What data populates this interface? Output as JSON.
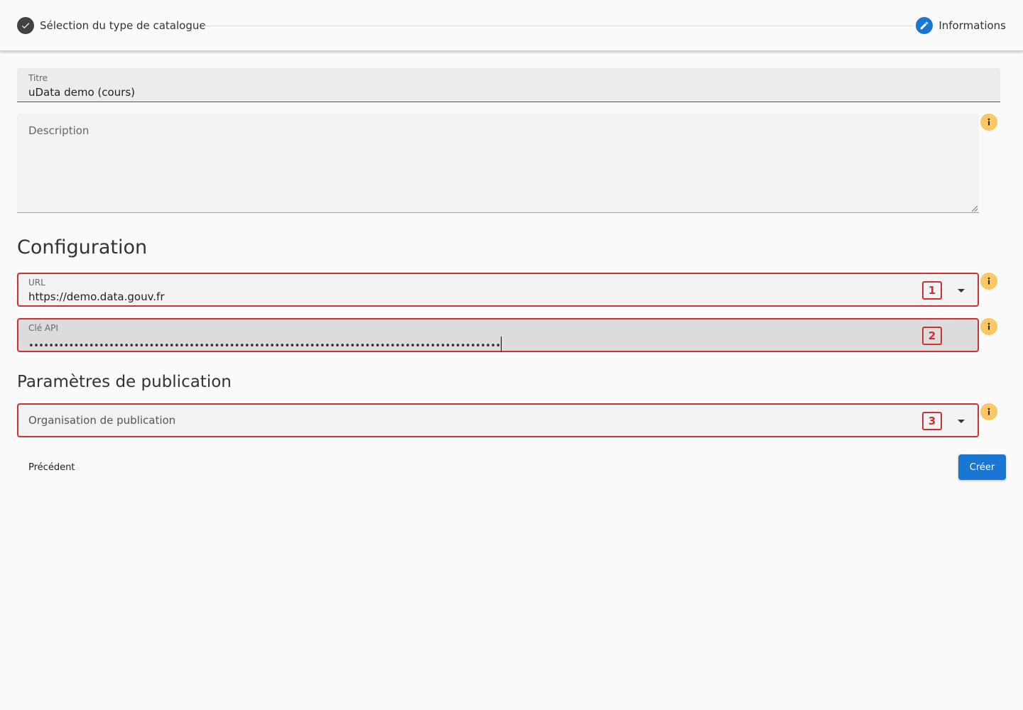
{
  "stepper": {
    "step1_label": "Sélection du type de catalogue",
    "step2_label": "Informations"
  },
  "form": {
    "titre": {
      "label": "Titre",
      "value": "uData demo (cours)"
    },
    "description": {
      "placeholder": "Description"
    },
    "configuration_heading": "Configuration",
    "url": {
      "label": "URL",
      "value": "https://demo.data.gouv.fr",
      "badge": "1"
    },
    "api_key": {
      "label": "Clé API",
      "value": "••••••••••••••••••••••••••••••••••••••••••••••••••••••••••••••••••••••••••••••••••••••••••••••",
      "badge": "2"
    },
    "publication_heading": "Paramètres de publication",
    "organisation": {
      "placeholder": "Organisation de publication",
      "badge": "3"
    }
  },
  "actions": {
    "previous_label": "Précédent",
    "create_label": "Créer"
  },
  "colors": {
    "accent": "#1976d2",
    "highlight": "#d32f2f",
    "info": "#fbc764"
  },
  "icons": {
    "step1": "check-icon",
    "step2": "pencil-icon",
    "info": "info-icon",
    "dropdown": "chevron-down-icon"
  }
}
